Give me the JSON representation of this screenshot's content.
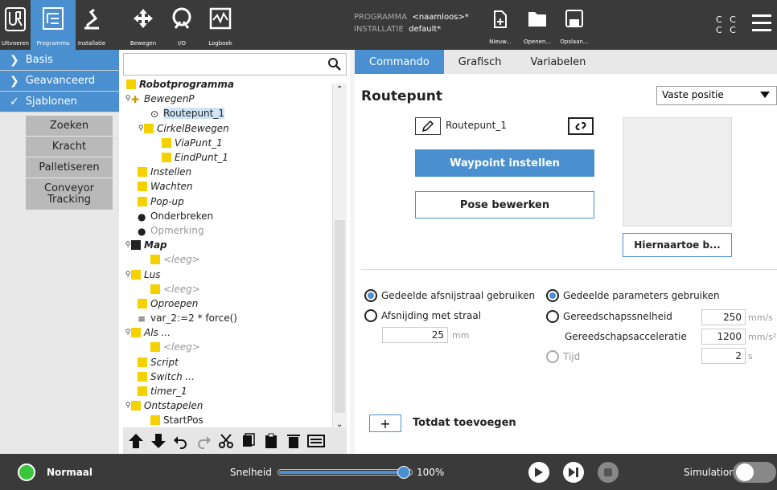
{
  "nav": {
    "items": [
      {
        "label": "Uitvoeren",
        "icon": "ur-logo-icon"
      },
      {
        "label": "Programma",
        "icon": "program-tree-icon"
      },
      {
        "label": "Installatie",
        "icon": "robot-arm-icon"
      },
      {
        "label": "Bewegen",
        "icon": "move-arrows-icon"
      },
      {
        "label": "I/O",
        "icon": "io-icon"
      },
      {
        "label": "Logboek",
        "icon": "log-icon"
      }
    ]
  },
  "program_info": {
    "program_label": "PROGRAMMA",
    "program_value": "<naamloos>*",
    "installation_label": "INSTALLATIE",
    "installation_value": "default*"
  },
  "file_buttons": {
    "new": "Nieuw...",
    "open": "Openen...",
    "save": "Opslaan..."
  },
  "cc": [
    "C C",
    "C C"
  ],
  "sidebar": {
    "basis": "Basis",
    "advanced": "Geavanceerd",
    "templates": "Sjablonen",
    "sub": [
      "Zoeken",
      "Kracht",
      "Palletiseren",
      "Conveyor Tracking"
    ]
  },
  "tree": {
    "nodes": [
      {
        "label": "Robotprogramma"
      },
      {
        "label": "BewegenP"
      },
      {
        "label": "Routepunt_1"
      },
      {
        "label": "CirkelBewegen"
      },
      {
        "label": "ViaPunt_1"
      },
      {
        "label": "EindPunt_1"
      },
      {
        "label": "Instellen"
      },
      {
        "label": "Wachten"
      },
      {
        "label": "Pop-up"
      },
      {
        "label": "Onderbreken"
      },
      {
        "label": "Opmerking"
      },
      {
        "label": "Map"
      },
      {
        "label": "<leeg>"
      },
      {
        "label": "Lus"
      },
      {
        "label": "<leeg>"
      },
      {
        "label": "Oproepen"
      },
      {
        "label": "var_2:=2 * force()"
      },
      {
        "label": "Als ..."
      },
      {
        "label": "<leeg>"
      },
      {
        "label": "Script"
      },
      {
        "label": "Switch ..."
      },
      {
        "label": "timer_1"
      },
      {
        "label": "Ontstapelen"
      },
      {
        "label": "StartPos"
      }
    ]
  },
  "tabs": [
    "Commando",
    "Grafisch",
    "Variabelen"
  ],
  "main": {
    "title": "Routepunt",
    "position_type": "Vaste positie",
    "waypoint_name": "Routepunt_1",
    "set_waypoint": "Waypoint instellen",
    "edit_pose": "Pose bewerken",
    "move_here": "Hiernaartoe b...",
    "shared_blend": "Gedeelde afsnijstraal gebruiken",
    "blend_radius": "Afsnijding met straal",
    "blend_value": "25",
    "blend_unit": "mm",
    "shared_params": "Gedeelde parameters gebruiken",
    "tool_speed": "Gereedschapssnelheid",
    "tool_speed_value": "250",
    "tool_speed_unit": "mm/s",
    "tool_accel": "Gereedschapsacceleratie",
    "tool_accel_value": "1200",
    "tool_accel_unit": "mm/s²",
    "time": "Tijd",
    "time_value": "2",
    "time_unit": "s",
    "add_until": "Totdat toevoegen",
    "add_symbol": "+"
  },
  "bottom": {
    "status": "Normaal",
    "speed_label": "Snelheid",
    "speed_value": "100%",
    "speed_fraction": 1.0,
    "simulation": "Simulation"
  },
  "colors": {
    "accent": "#4a90d0",
    "status_ok": "#3ac63a",
    "node_icon": "#f5d100"
  }
}
